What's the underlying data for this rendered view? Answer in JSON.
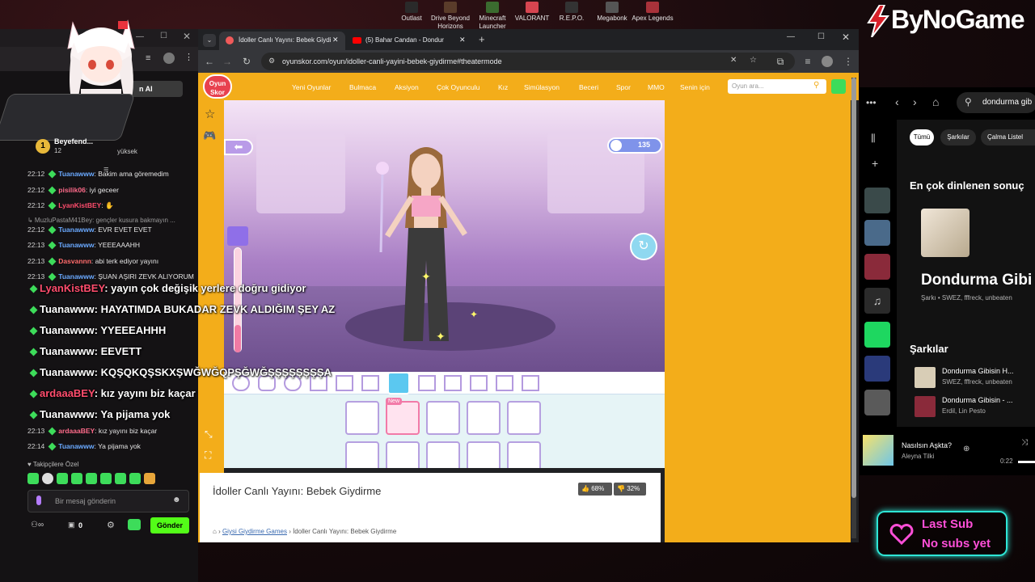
{
  "desktop": {
    "top_games": [
      "Outlast",
      "Drive Beyond Horizons",
      "Minecraft Launcher",
      "VALORANT",
      "R.E.P.O.",
      "Megabonk",
      "Apex Legends"
    ],
    "brand": "ByNoGame"
  },
  "chat": {
    "avatar_label": "n AI",
    "top_user": {
      "rank": "1",
      "name": "Beyefend...",
      "count": "12"
    },
    "top_user_sub": "yüksek",
    "lines": [
      {
        "time": "22:12",
        "user": "Tuanawww",
        "text": "Bakim ama göremedim",
        "color": "#6aa9ff"
      },
      {
        "time": "22:12",
        "user": "pisilik06",
        "text": "iyi geceer",
        "color": "#ff6b8a"
      },
      {
        "time": "22:12",
        "user": "LyanKistBEY",
        "text": "",
        "color": "#ff4d6d"
      },
      {
        "time": "",
        "user": "",
        "text": "↳ MuzluPastaM41Bey: gençler kusura bakmayın ...",
        "color": "#aaaaaa"
      },
      {
        "time": "22:12",
        "user": "Tuanawww",
        "text": "EVR EVET EVET",
        "color": "#6aa9ff"
      },
      {
        "time": "22:13",
        "user": "Tuanawww",
        "text": "YEEEAAAHH",
        "color": "#6aa9ff"
      },
      {
        "time": "22:13",
        "user": "Dasvannn",
        "text": "abi terk ediyor yayını",
        "color": "#ff6b6b"
      },
      {
        "time": "22:13",
        "user": "Tuanawww",
        "text": "ŞUAN AŞIRI ZEVK ALIYORUM",
        "color": "#6aa9ff"
      }
    ],
    "bottom_lines": [
      {
        "time": "22:13",
        "user": "ardaaaBEY",
        "text": "kız yayını biz kaçar",
        "color": "#ff6b8a"
      },
      {
        "time": "22:14",
        "user": "Tuanawww",
        "text": "Ya pijama yok",
        "color": "#6aa9ff"
      }
    ],
    "overlay_lines": [
      {
        "user": "LyanKistBEY",
        "text": "yayın çok değişik yerlere doğru gidiyor"
      },
      {
        "user": "Tuanawww",
        "text": "HAYATIMDA BUKADAR ZEVK ALDIĞIM ŞEY AZ"
      },
      {
        "user": "Tuanawww",
        "text": "YYEEEAHHH"
      },
      {
        "user": "Tuanawww",
        "text": "EEVETT"
      },
      {
        "user": "Tuanawww",
        "text": "KQŞQKQŞSKXŞWĞWĞQPŞĞWĞŞŞŞŞŞŞŞŞA"
      },
      {
        "user": "ardaaaBEY",
        "text": "kız yayını biz kaçar"
      },
      {
        "user": "Tuanawww",
        "text": "Ya pijama yok"
      }
    ],
    "followers_label": "Takipçilere Özel",
    "input_placeholder": "Bir mesaj gönderin",
    "points": "0",
    "send_label": "Gönder"
  },
  "browser": {
    "tabs": [
      {
        "title": "İdoller Canlı Yayını: Bebek Giydi",
        "active": true
      },
      {
        "title": "(5) Bahar Candan - Dondur",
        "active": false
      }
    ],
    "url": "oyunskor.com/oyun/idoller-canli-yayini-bebek-giydirme#theatermode"
  },
  "site": {
    "logo_top": "Oyun",
    "logo_bottom": "Skor",
    "menu": [
      "Yeni Oyunlar",
      "Bulmaca",
      "Aksiyon",
      "Çok Oyunculu",
      "Kız",
      "Simülasyon",
      "Beceri",
      "Spor",
      "MMO",
      "Senin için"
    ],
    "search_placeholder": "Oyun ara...",
    "game_counter": "135",
    "new_badge": "New",
    "title": "İdoller Canlı Yayını: Bebek Giydirme",
    "like_pct": "68%",
    "dislike_pct": "32%",
    "breadcrumb_category": "Giysi Giydirme Games",
    "breadcrumb_current": "İdoller Canlı Yayını: Bebek Giydirme"
  },
  "spotify": {
    "search_value": "dondurma gib",
    "filters": [
      "Tümü",
      "Şarkılar",
      "Çalma Listel"
    ],
    "top_heading": "En çok dinlenen sonuç",
    "top_title": "Dondurma Gibi",
    "top_meta": "Şarkı • SWEZ, fffreck, unbeaten",
    "songs_heading": "Şarkılar",
    "songs": [
      {
        "title": "Dondurma Gibisin H...",
        "artists": "SWEZ, fffreck, unbeaten"
      },
      {
        "title": "Dondurma Gibisin - ...",
        "artists": "Erdil, Lin Pesto"
      }
    ],
    "now_playing_title": "Nasılsın Aşkta?",
    "now_playing_artist": "Aleyna Tilki",
    "elapsed": "0:22"
  },
  "last_sub": {
    "title": "Last Sub",
    "value": "No subs yet"
  }
}
